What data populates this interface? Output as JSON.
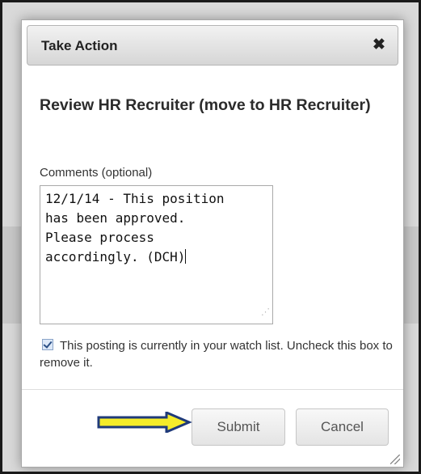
{
  "dialog": {
    "title": "Take Action",
    "close_glyph": "✖",
    "heading": "Review HR Recruiter (move to HR Recruiter)",
    "comments_label": "Comments (optional)",
    "comments_value": "12/1/14 - This position\nhas been approved.\nPlease process\naccordingly. (DCH)",
    "watch_checked": true,
    "watch_text": "This posting is currently in your watch list. Uncheck this box to remove it.",
    "submit_label": "Submit",
    "cancel_label": "Cancel"
  },
  "annotation": {
    "icon": "arrow-right-icon",
    "fill_color": "#f5ec2a",
    "stroke_color": "#1f3a7a"
  }
}
